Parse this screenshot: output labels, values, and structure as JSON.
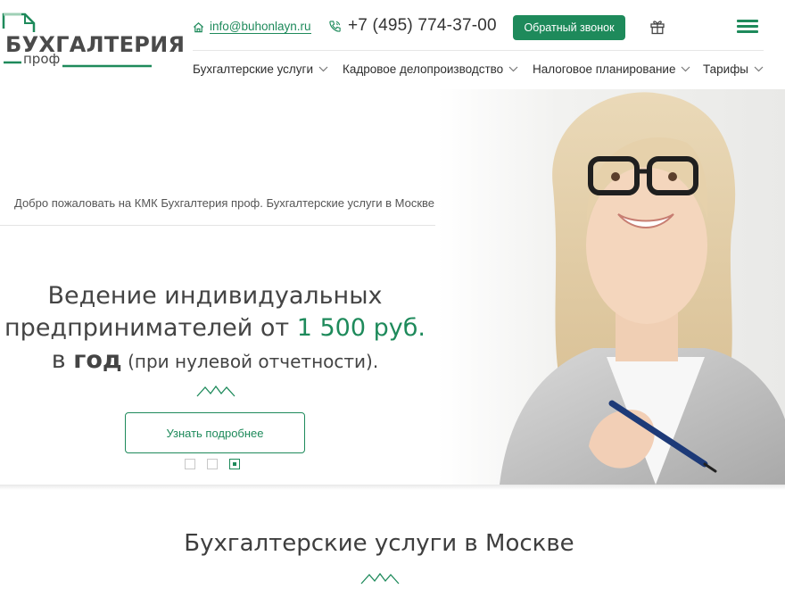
{
  "brand": {
    "title": "БУХГАЛТЕРИЯ",
    "subtitle": "проф",
    "accent_color": "#1e8a5b"
  },
  "header": {
    "email": "info@buhonlayn.ru",
    "phone": "+7 (495) 774-37-00",
    "callback_label": "Обратный звонок",
    "icons": [
      "home-icon",
      "phone-icon",
      "gift-icon",
      "menu-icon"
    ]
  },
  "nav": {
    "items": [
      {
        "label": "Бухгалтерские услуги"
      },
      {
        "label": "Кадровое делопроизводство"
      },
      {
        "label": "Налоговое планирование"
      },
      {
        "label": "Тарифы"
      }
    ]
  },
  "hero": {
    "welcome": "Добро пожаловать на КМК Бухгалтерия проф. Бухгалтерские услуги в Москве",
    "headline_part1": "Ведение индивидуальных предпринимателей от ",
    "headline_price": "1 500 руб.",
    "headline_part2": " в ",
    "headline_year": "год",
    "headline_note": " (при нулевой отчетности).",
    "button_label": "Узнать подробнее",
    "slides_total": 3,
    "slide_active": 3
  },
  "services": {
    "title": "Бухгалтерские услуги в Москве"
  }
}
